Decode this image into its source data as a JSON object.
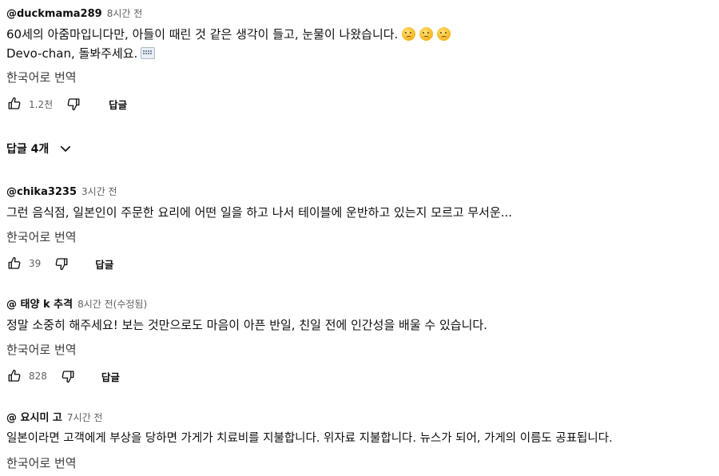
{
  "comments": [
    {
      "author": "@duckmama289",
      "time": "8시간 전",
      "line1": "60세의 아줌마입니다만, 아들이 때린 것 같은 생각이 들고, 눈물이 나왔습니다.",
      "line2": "Devo-chan, 돌봐주세요.",
      "translate": "한국어로 번역",
      "likes": "1.2천",
      "reply": "답글"
    },
    {
      "author": "@chika3235",
      "time": "3시간 전",
      "line1": "그런 음식점, 일본인이 주문한 요리에 어떤 일을 하고 나서 테이블에 운반하고 있는지 모르고 무서운...",
      "translate": "한국어로 번역",
      "likes": "39",
      "reply": "답글"
    },
    {
      "author": "@ 태양 k 추격",
      "time": "8시간 전(수정됨)",
      "line1": "정말 소중히 해주세요! 보는 것만으로도 마음이 아픈 반일, 친일 전에 인간성을 배울 수 있습니다.",
      "translate": "한국어로 번역",
      "likes": "828",
      "reply": "답글"
    },
    {
      "author": "@ 요시미 고",
      "time": "7시간 전",
      "line1": "일본이라면 고객에게 부상을 당하면 가게가 치료비를 지불합니다. 위자료 지불합니다. 뉴스가 되어, 가게의 이름도 공표됩니다.",
      "translate": "한국어로 번역"
    }
  ],
  "replies_toggle": {
    "label": "답글 4개"
  },
  "icons": {
    "like": "thumbs-up-icon",
    "dislike": "thumbs-down-icon",
    "chevron": "chevron-down-icon",
    "emoji": "sad-face-emoji-icon",
    "keyboard": "keyboard-emoji-icon"
  },
  "colors": {
    "text": "#0f0f0f",
    "secondary": "#606060",
    "translate": "#3d3d3d"
  }
}
